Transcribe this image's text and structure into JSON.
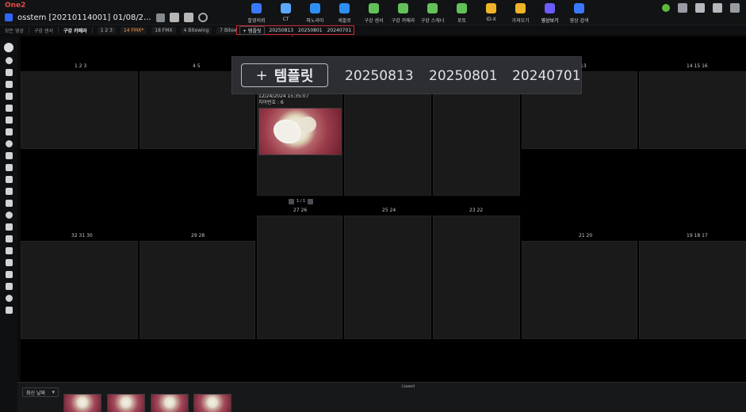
{
  "app": {
    "brand": "One2",
    "patient_label": "osstem  [20210114001] 01/08/2..."
  },
  "top_nav": {
    "items": [
      {
        "label": "촬영의뢰",
        "color": "#3a79ff"
      },
      {
        "label": "CT",
        "color": "#5aa8ff"
      },
      {
        "label": "파노라마",
        "color": "#2f8ef2"
      },
      {
        "label": "세팔로",
        "color": "#2f8ef2"
      },
      {
        "label": "구강 센서",
        "color": "#63c15a"
      },
      {
        "label": "구강 카메라",
        "color": "#63c15a"
      },
      {
        "label": "구강 스캐너",
        "color": "#63c15a"
      },
      {
        "label": "포토",
        "color": "#63c15a"
      },
      {
        "label": "ID-X",
        "color": "#f0b429"
      },
      {
        "label": "가져오기",
        "color": "#f0b429"
      },
      {
        "label": "영상보기",
        "color": "#6b5cff",
        "active": true
      },
      {
        "label": "영상 검색",
        "color": "#3a79ff"
      }
    ]
  },
  "sub_toolbar": {
    "crumbs": [
      "모든 영상",
      "구강 센서",
      "구강 카메라"
    ],
    "pills": [
      "1 2 3",
      "14 FMX*",
      "18 FMX",
      "4 Bitewing",
      "7 Bitewing",
      "포토"
    ],
    "template_button": "+ 템플릿",
    "template_dates": [
      "20250813",
      "20250801",
      "20240701"
    ]
  },
  "zoom_popup": {
    "button": "템플릿",
    "dates": [
      "20250813",
      "20250801",
      "20240701"
    ]
  },
  "grid_labels": {
    "r1": {
      "a": "1 2 3",
      "b": "4 5",
      "c": "13",
      "d": "14 15 16"
    },
    "r2": {
      "a": "27 26",
      "b": "25 24",
      "c": "23 22"
    },
    "r3": {
      "a": "32 31 30",
      "b": "29 28",
      "c": "21 20",
      "d": "19 18 17"
    }
  },
  "selected_image_meta": {
    "datetime": "12/24/2024 15:35:07",
    "tooth_no": "치아번호 : 6"
  },
  "pager": {
    "text": "1 / 1"
  },
  "bottom_bar": {
    "sort_label": "최신 날짜",
    "center_label": "Liaaeii"
  }
}
